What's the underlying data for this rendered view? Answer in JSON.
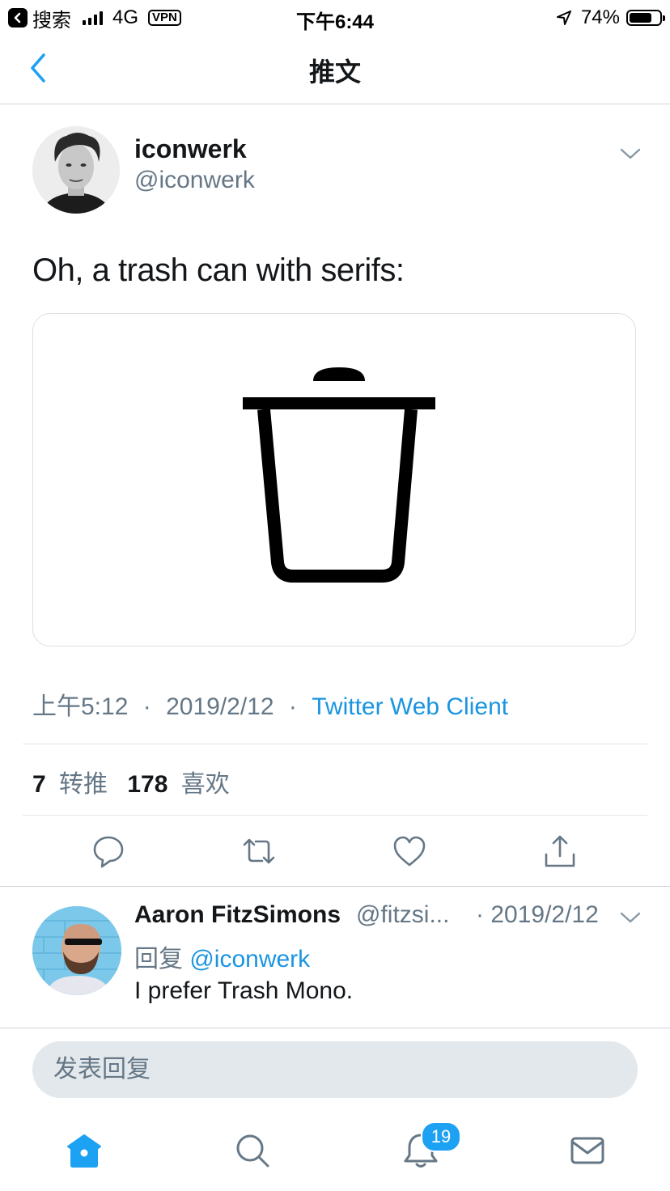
{
  "status_bar": {
    "back_app": "搜索",
    "network": "4G",
    "vpn": "VPN",
    "time": "下午6:44",
    "battery": "74%",
    "battery_level": 0.74
  },
  "nav": {
    "title": "推文",
    "back_icon": "chevron-left-icon"
  },
  "tweet": {
    "author_name": "iconwerk",
    "author_handle": "@iconwerk",
    "text": "Oh, a trash can with serifs:",
    "media_icon": "trash-can-icon",
    "time": "上午5:12",
    "date": "2019/2/12",
    "separator": "·",
    "client": "Twitter Web Client",
    "retweet_count": "7",
    "retweet_label": "转推",
    "like_count": "178",
    "like_label": "喜欢"
  },
  "actions": [
    {
      "icon": "reply-icon"
    },
    {
      "icon": "retweet-icon"
    },
    {
      "icon": "heart-icon"
    },
    {
      "icon": "share-icon"
    }
  ],
  "reply": {
    "author_name": "Aaron FitzSimons",
    "author_handle": "@fitzsi...",
    "date": "· 2019/2/12",
    "reply_prefix": "回复",
    "reply_to": "@iconwerk",
    "text": "I prefer Trash Mono."
  },
  "compose": {
    "placeholder": "发表回复"
  },
  "tab_bar": {
    "items": [
      {
        "icon": "home-icon"
      },
      {
        "icon": "search-icon"
      },
      {
        "icon": "bell-icon"
      },
      {
        "icon": "mail-icon"
      }
    ],
    "notification_badge": "19"
  },
  "colors": {
    "accent": "#1da1f2",
    "link": "#1b95e0",
    "secondary_text": "#657786",
    "primary_text": "#14171a"
  }
}
